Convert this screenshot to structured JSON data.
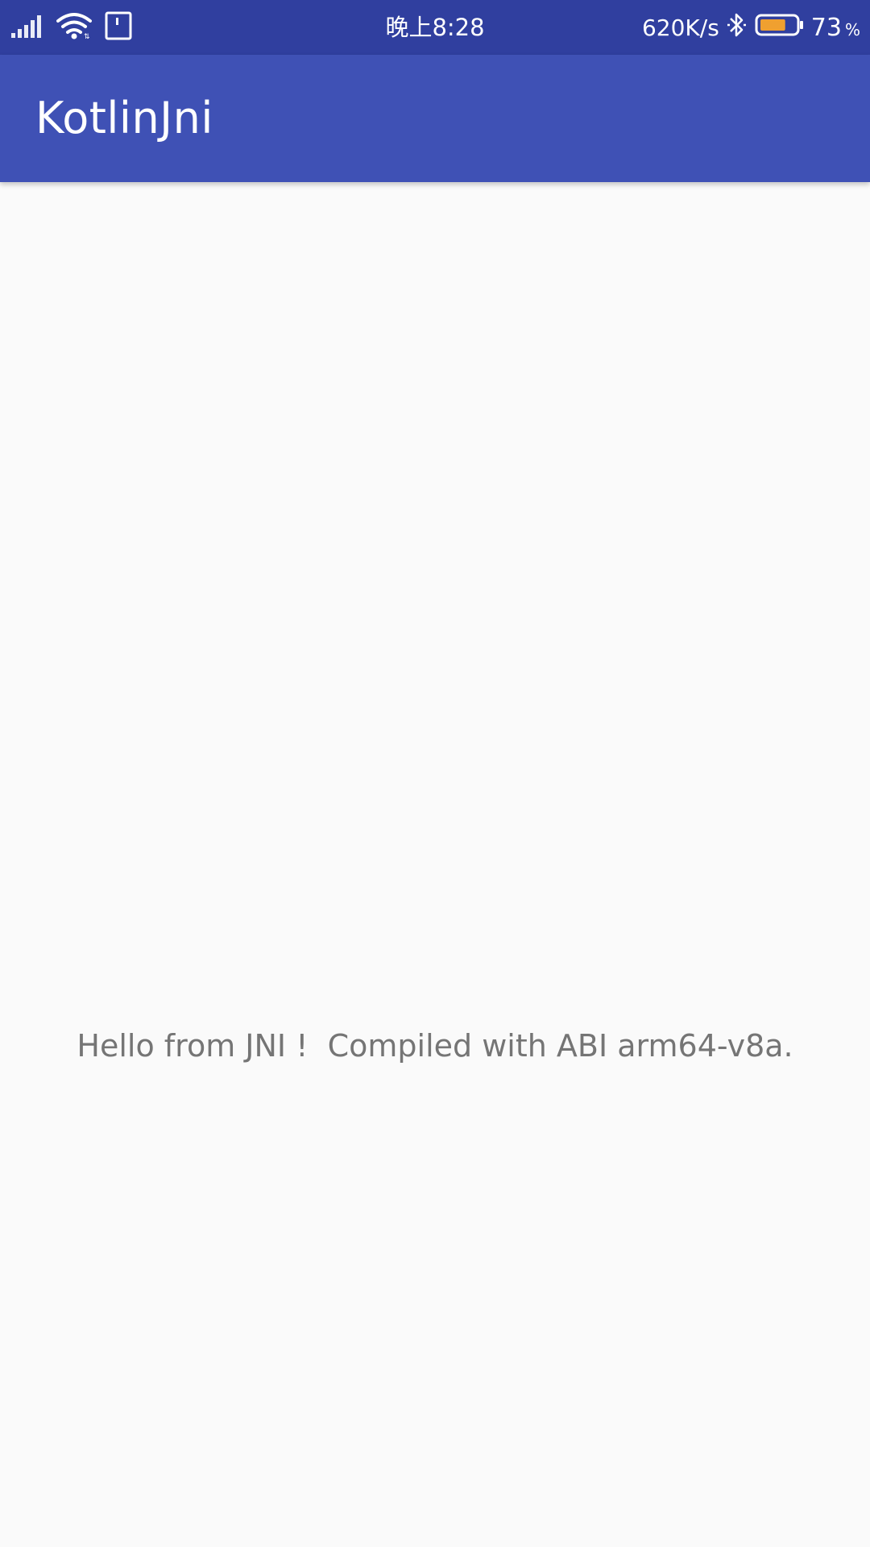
{
  "status_bar": {
    "time": "晚上8:28",
    "network_speed": "620K/s",
    "battery_level": "73",
    "battery_unit": "%",
    "battery_fraction": 0.73,
    "background_color": "#303f9f",
    "battery_fill_color": "#f0a030",
    "icons": [
      "signal-bars-icon",
      "wifi-icon",
      "sim-card-icon",
      "bluetooth-icon",
      "battery-icon"
    ]
  },
  "app_bar": {
    "title": "KotlinJni",
    "background_color": "#3f51b5"
  },
  "main": {
    "message": "Hello from JNI !  Compiled with ABI arm64-v8a.",
    "text_color": "#757575",
    "background_color": "#fafafa"
  }
}
